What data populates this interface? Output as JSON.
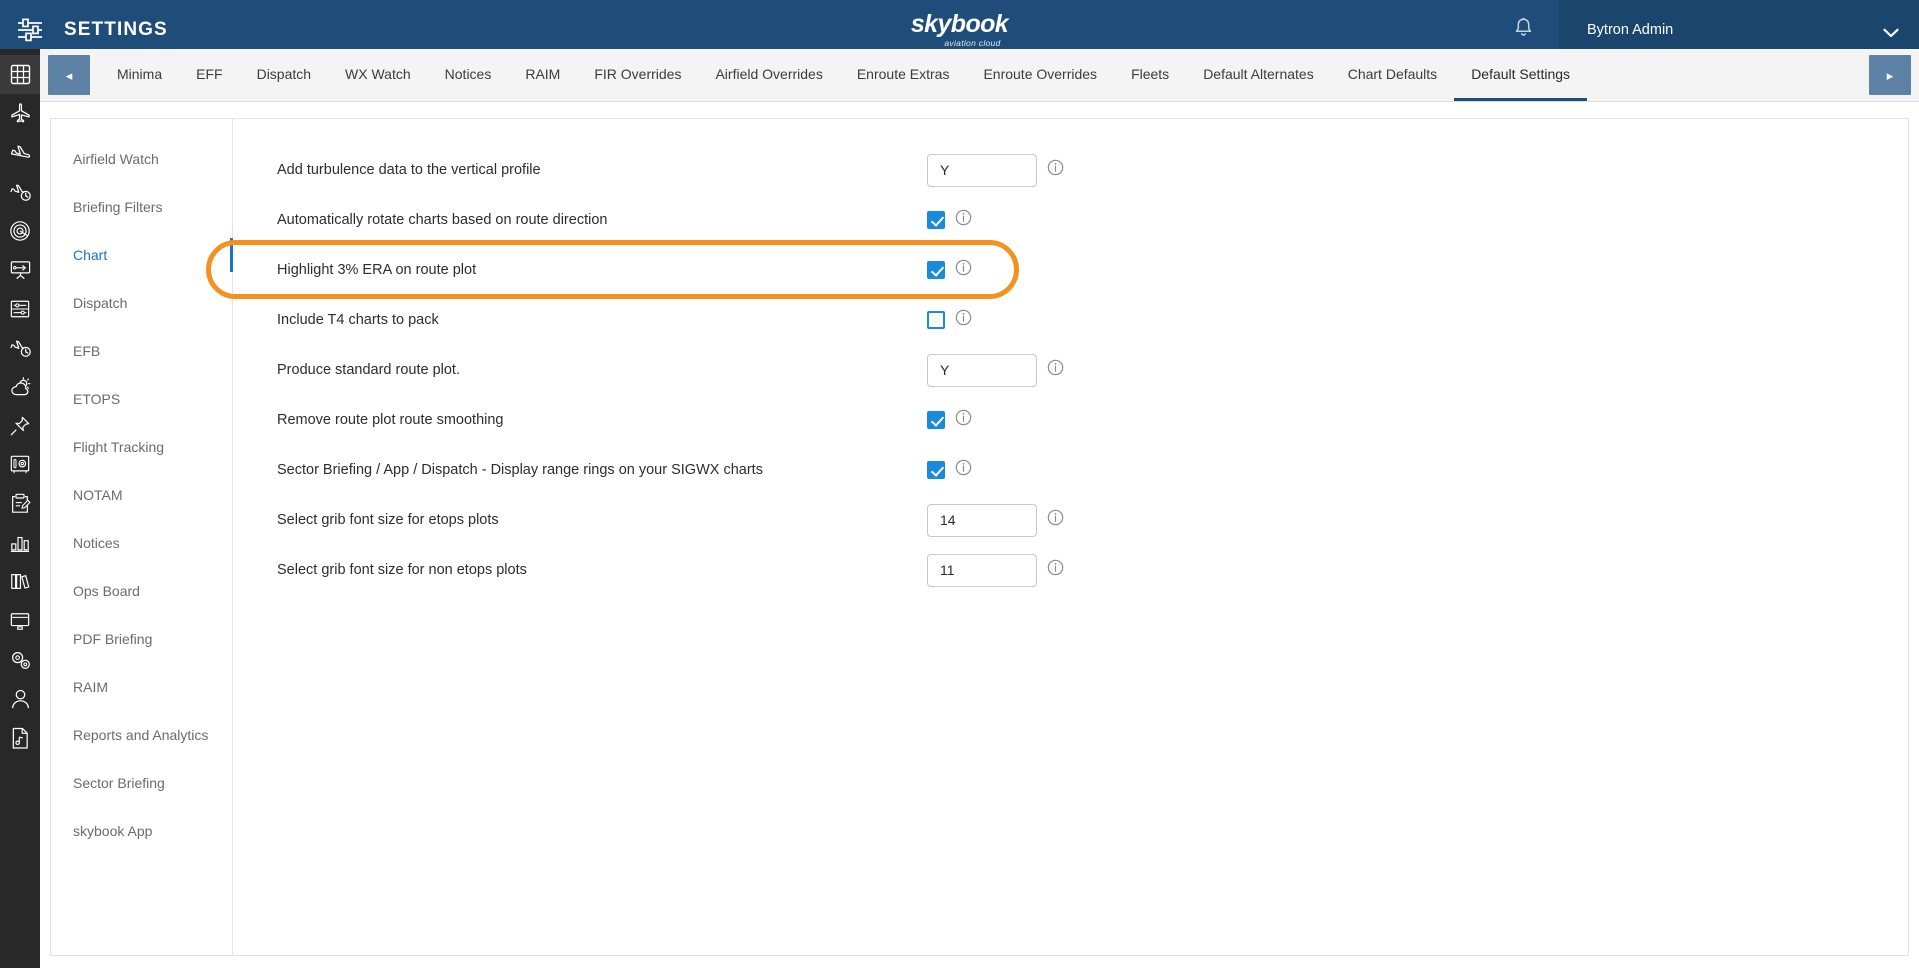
{
  "header": {
    "title": "SETTINGS",
    "settings_icon": "sliders-icon",
    "brand_name": "skybook",
    "brand_sub": "aviation cloud",
    "bell_icon": "bell-icon",
    "user_name": "Bytron Admin",
    "chevron_icon": "chevron-down-icon",
    "accent_color": "#1e4d79"
  },
  "rail": {
    "items": [
      {
        "icon": "grid-icon",
        "active": true
      },
      {
        "icon": "airplane-icon",
        "active": false
      },
      {
        "icon": "airplane-takeoff-icon",
        "active": false
      },
      {
        "icon": "airplane-clock-icon",
        "active": false
      },
      {
        "icon": "radar-icon",
        "active": false
      },
      {
        "icon": "presentation-flight-icon",
        "active": false
      },
      {
        "icon": "list-sliders-icon",
        "active": false
      },
      {
        "icon": "airplane-time-icon",
        "active": false
      },
      {
        "icon": "weather-sun-cloud-icon",
        "active": false
      },
      {
        "icon": "pin-icon",
        "active": false
      },
      {
        "icon": "safe-vault-icon",
        "active": false
      },
      {
        "icon": "clipboard-edit-icon",
        "active": false
      },
      {
        "icon": "bar-chart-icon",
        "active": false
      },
      {
        "icon": "books-icon",
        "active": false
      },
      {
        "icon": "monitor-icon",
        "active": false
      },
      {
        "icon": "gears-icon",
        "active": false
      },
      {
        "icon": "user-icon",
        "active": false
      },
      {
        "icon": "document-music-icon",
        "active": false
      }
    ]
  },
  "tabbar": {
    "prev_label": "◂",
    "next_label": "▸",
    "tabs": [
      {
        "label": "Minima",
        "active": false
      },
      {
        "label": "EFF",
        "active": false
      },
      {
        "label": "Dispatch",
        "active": false
      },
      {
        "label": "WX Watch",
        "active": false
      },
      {
        "label": "Notices",
        "active": false
      },
      {
        "label": "RAIM",
        "active": false
      },
      {
        "label": "FIR Overrides",
        "active": false
      },
      {
        "label": "Airfield Overrides",
        "active": false
      },
      {
        "label": "Enroute Extras",
        "active": false
      },
      {
        "label": "Enroute Overrides",
        "active": false
      },
      {
        "label": "Fleets",
        "active": false
      },
      {
        "label": "Default Alternates",
        "active": false
      },
      {
        "label": "Chart Defaults",
        "active": false
      },
      {
        "label": "Default Settings",
        "active": true
      }
    ]
  },
  "sidebar": {
    "items": [
      {
        "label": "Airfield Watch",
        "active": false
      },
      {
        "label": "Briefing Filters",
        "active": false
      },
      {
        "label": "Chart",
        "active": true
      },
      {
        "label": "Dispatch",
        "active": false
      },
      {
        "label": "EFB",
        "active": false
      },
      {
        "label": "ETOPS",
        "active": false
      },
      {
        "label": "Flight Tracking",
        "active": false
      },
      {
        "label": "NOTAM",
        "active": false
      },
      {
        "label": "Notices",
        "active": false
      },
      {
        "label": "Ops Board",
        "active": false
      },
      {
        "label": "PDF Briefing",
        "active": false
      },
      {
        "label": "RAIM",
        "active": false
      },
      {
        "label": "Reports and Analytics",
        "active": false
      },
      {
        "label": "Sector Briefing",
        "active": false
      },
      {
        "label": "skybook App",
        "active": false
      }
    ]
  },
  "settings": {
    "rows": [
      {
        "label": "Add turbulence data to the vertical profile",
        "control": "text",
        "value": "Y",
        "info": "info-icon"
      },
      {
        "label": "Automatically rotate charts based on route direction",
        "control": "checkbox",
        "checked": true,
        "info": "info-icon"
      },
      {
        "label": "Highlight 3% ERA on route plot",
        "control": "checkbox",
        "checked": true,
        "info": "info-icon",
        "highlighted": true
      },
      {
        "label": "Include T4 charts to pack",
        "control": "checkbox",
        "checked": false,
        "info": "info-icon"
      },
      {
        "label": "Produce standard route plot.",
        "control": "text",
        "value": "Y",
        "info": "info-icon"
      },
      {
        "label": "Remove route plot route smoothing",
        "control": "checkbox",
        "checked": true,
        "info": "info-icon"
      },
      {
        "label": "Sector Briefing / App / Dispatch - Display range rings on your SIGWX charts",
        "control": "checkbox",
        "checked": true,
        "info": "info-icon"
      },
      {
        "label": "Select grib font size for etops plots",
        "control": "text",
        "value": "14",
        "info": "info-icon"
      },
      {
        "label": "Select grib font size for non etops plots",
        "control": "text",
        "value": "11",
        "info": "info-icon"
      }
    ],
    "annotation_color": "#f5911e"
  }
}
